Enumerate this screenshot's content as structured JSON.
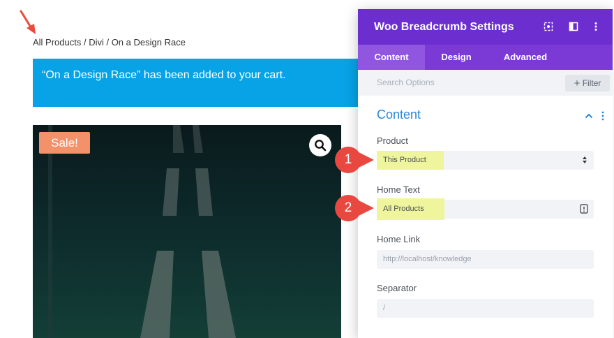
{
  "page": {
    "breadcrumb": "All Products / Divi / On a Design Race",
    "notice": "“On a Design Race” has been added to your cart.",
    "sale_badge": "Sale!",
    "colors": {
      "notice_bg": "#07a3e6",
      "sale_bg": "#f3916b",
      "arrow": "#e74c3c"
    }
  },
  "panel": {
    "title": "Woo Breadcrumb Settings",
    "header_icons": [
      "target-icon",
      "columns-icon",
      "more-vertical-icon"
    ],
    "tabs": [
      {
        "label": "Content",
        "active": true
      },
      {
        "label": "Design",
        "active": false
      },
      {
        "label": "Advanced",
        "active": false
      }
    ],
    "search_placeholder": "Search Options",
    "filter_label": "Filter",
    "section_title": "Content",
    "fields": {
      "product": {
        "label": "Product",
        "value": "This Product"
      },
      "home_text": {
        "label": "Home Text",
        "value": "All Products"
      },
      "home_link": {
        "label": "Home Link",
        "value": "http://localhost/knowledge"
      },
      "separator": {
        "label": "Separator",
        "value": "/"
      }
    },
    "colors": {
      "header": "#6c2ecf",
      "tabs": "#7b3ad6",
      "active_tab": "#9156e0",
      "accent": "#2b87da",
      "highlight": "#eef48c"
    }
  },
  "callouts": {
    "first": "1",
    "second": "2",
    "color": "#e8483f"
  }
}
